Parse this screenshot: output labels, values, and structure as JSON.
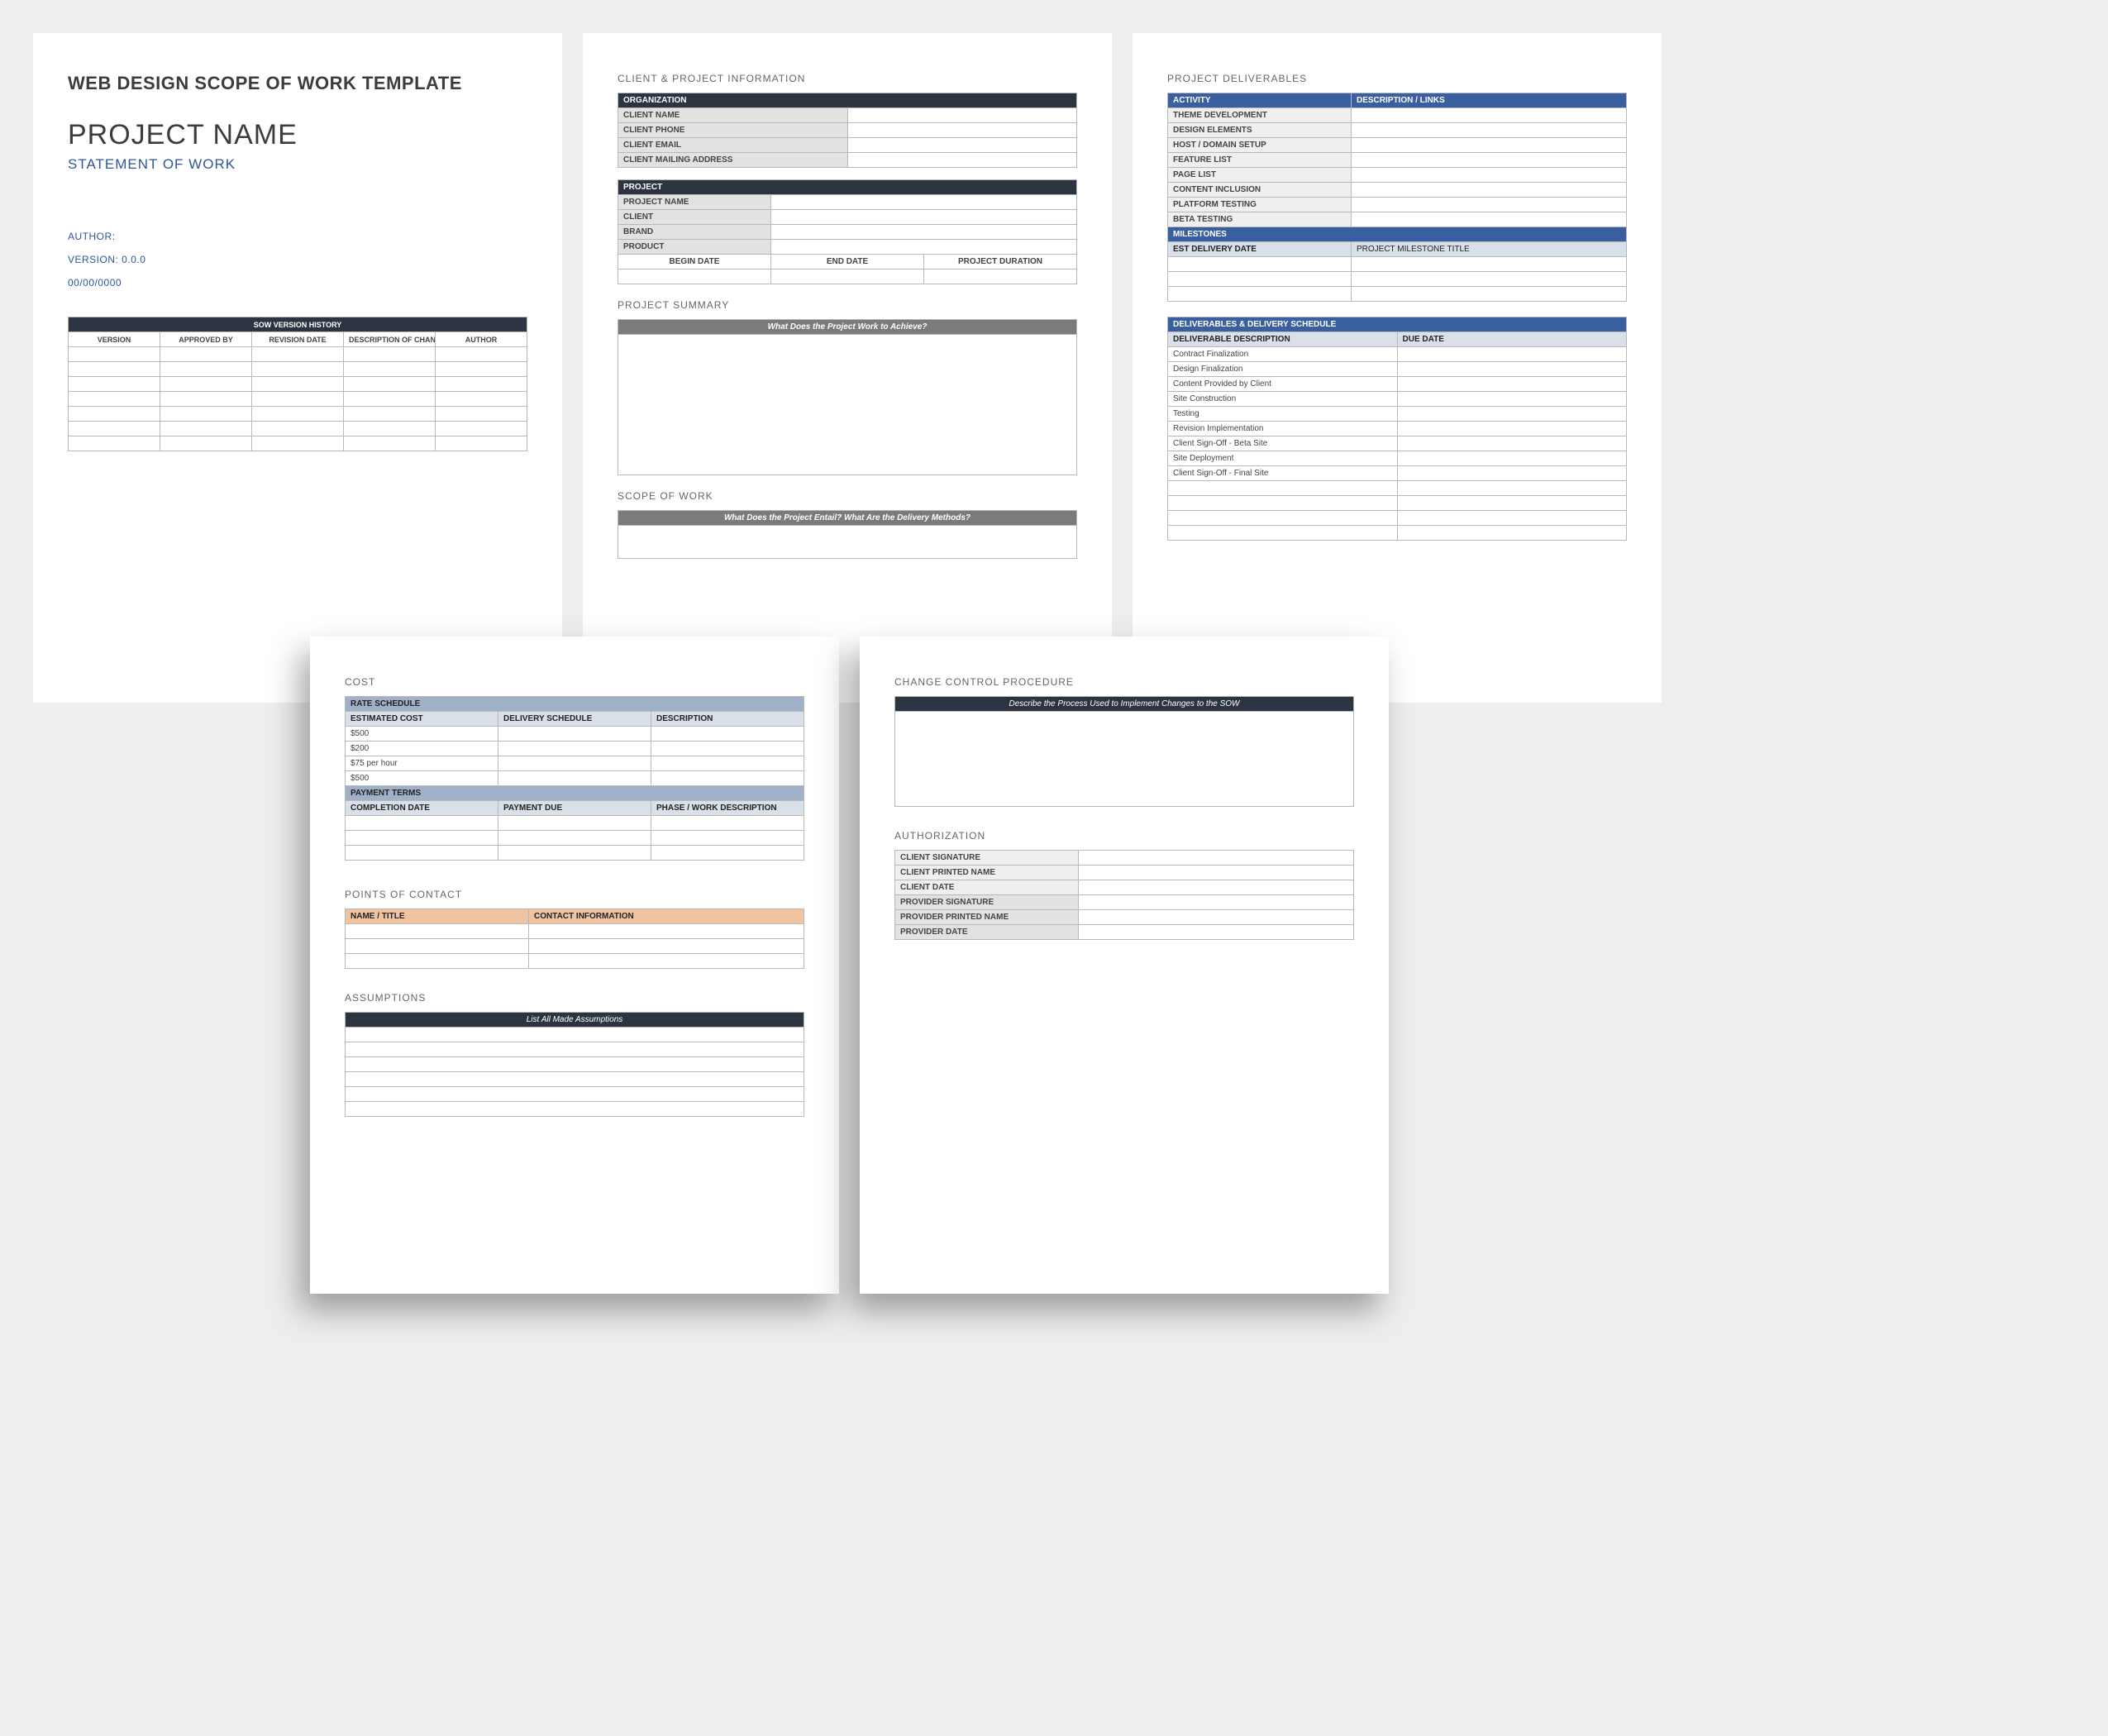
{
  "page1": {
    "template_title": "WEB DESIGN SCOPE OF WORK TEMPLATE",
    "project_name": "PROJECT NAME",
    "statement": "STATEMENT OF WORK",
    "author_label": "AUTHOR:",
    "version_label": "VERSION: 0.0.0",
    "date_label": "00/00/0000",
    "history_title": "SOW VERSION HISTORY",
    "history_headers": {
      "version": "VERSION",
      "approved_by": "APPROVED BY",
      "revision_date": "REVISION DATE",
      "description": "DESCRIPTION OF CHANGE",
      "author": "AUTHOR"
    }
  },
  "page2": {
    "client_project_info": "CLIENT & PROJECT INFORMATION",
    "organization": "ORGANIZATION",
    "org_rows": {
      "client_name": "CLIENT NAME",
      "client_phone": "CLIENT  PHONE",
      "client_email": "CLIENT EMAIL",
      "client_mailing": "CLIENT MAILING ADDRESS"
    },
    "project": "PROJECT",
    "proj_rows": {
      "project_name": "PROJECT NAME",
      "client": "CLIENT",
      "brand": "BRAND",
      "product": "PRODUCT"
    },
    "date_headers": {
      "begin": "BEGIN DATE",
      "end": "END DATE",
      "duration": "PROJECT DURATION"
    },
    "project_summary": "PROJECT SUMMARY",
    "summary_prompt": "What Does the Project Work to Achieve?",
    "scope_of_work": "SCOPE OF WORK",
    "scope_prompt": "What Does the Project Entail? What Are the Delivery Methods?"
  },
  "page3": {
    "deliverables_title": "PROJECT DELIVERABLES",
    "activity": "ACTIVITY",
    "description_links": "DESCRIPTION / LINKS",
    "activities": {
      "theme": "THEME DEVELOPMENT",
      "design": "DESIGN ELEMENTS",
      "host": "HOST / DOMAIN SETUP",
      "feature": "FEATURE LIST",
      "page": "PAGE LIST",
      "content": "CONTENT INCLUSION",
      "platform": "PLATFORM TESTING",
      "beta": "BETA TESTING"
    },
    "milestones": "MILESTONES",
    "est_delivery": "EST DELIVERY DATE",
    "milestone_title": "PROJECT MILESTONE TITLE",
    "dds_header": "DELIVERABLES & DELIVERY SCHEDULE",
    "deliverable_desc": "DELIVERABLE DESCRIPTION",
    "due_date": "DUE DATE",
    "schedule_items": {
      "a": "Contract Finalization",
      "b": "Design Finalization",
      "c": "Content Provided by Client",
      "d": "Site Construction",
      "e": "Testing",
      "f": "Revision Implementation",
      "g": "Client Sign-Off - Beta Site",
      "h": "Site Deployment",
      "i": "Client Sign-Off - Final Site"
    }
  },
  "page4": {
    "cost": "COST",
    "rate_schedule": "RATE SCHEDULE",
    "rate_headers": {
      "estimated_cost": "ESTIMATED COST",
      "delivery_schedule": "DELIVERY SCHEDULE",
      "description": "DESCRIPTION"
    },
    "rate_rows": {
      "r1": "$500",
      "r2": "$200",
      "r3": "$75 per hour",
      "r4": "$500"
    },
    "payment_terms": "PAYMENT TERMS",
    "payment_headers": {
      "completion_date": "COMPLETION DATE",
      "payment_due": "PAYMENT DUE",
      "phase": "PHASE / WORK DESCRIPTION"
    },
    "poc": "POINTS OF CONTACT",
    "poc_headers": {
      "name_title": "NAME / TITLE",
      "contact_info": "CONTACT INFORMATION"
    },
    "assumptions": "ASSUMPTIONS",
    "assumptions_prompt": "List All Made Assumptions"
  },
  "page5": {
    "change_control": "CHANGE CONTROL PROCEDURE",
    "change_prompt": "Describe the Process Used to Implement Changes to the SOW",
    "authorization": "AUTHORIZATION",
    "auth_rows": {
      "client_sig": "CLIENT SIGNATURE",
      "client_name": "CLIENT PRINTED NAME",
      "client_date": "CLIENT DATE",
      "provider_sig": "PROVIDER SIGNATURE",
      "provider_name": "PROVIDER PRINTED NAME",
      "provider_date": "PROVIDER DATE"
    }
  }
}
